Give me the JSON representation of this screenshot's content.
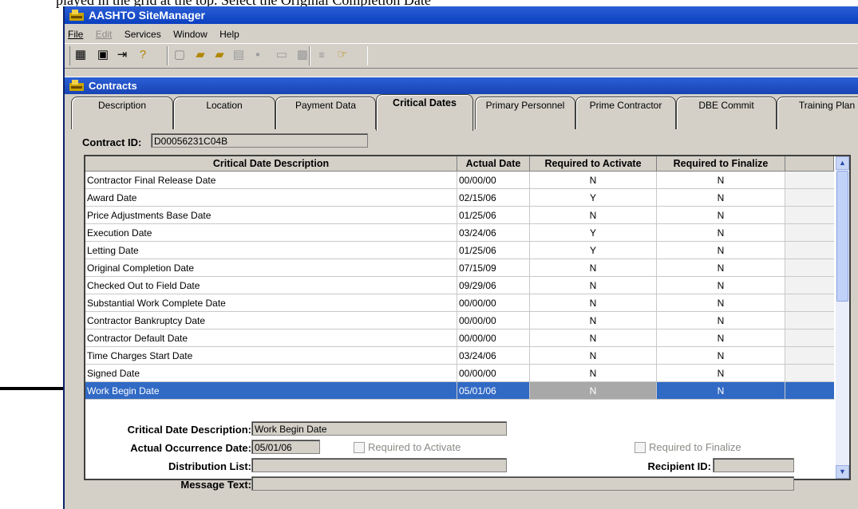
{
  "doc_text": "played in the grid at the top. Select the Original Completion Date",
  "app": {
    "title": "AASHTO SiteManager",
    "menu": [
      {
        "label": "File",
        "disabled": false
      },
      {
        "label": "Edit",
        "disabled": true
      },
      {
        "label": "Services",
        "disabled": false
      },
      {
        "label": "Window",
        "disabled": false
      },
      {
        "label": "Help",
        "disabled": false
      }
    ]
  },
  "window": {
    "title": "Contracts",
    "tabs": [
      "Description",
      "Location",
      "Payment Data",
      "Critical Dates",
      "Primary Personnel",
      "Prime Contractor",
      "DBE Commit",
      "Training Plan"
    ],
    "active_tab": "Critical Dates"
  },
  "contract": {
    "label": "Contract ID:",
    "value": "D00056231C04B"
  },
  "grid": {
    "headers": [
      "Critical Date Description",
      "Actual Date",
      "Required to Activate",
      "Required to Finalize"
    ],
    "rows": [
      {
        "desc": "Contractor Final Release Date",
        "date": "00/00/00",
        "act": "N",
        "fin": "N"
      },
      {
        "desc": "Award Date",
        "date": "02/15/06",
        "act": "Y",
        "fin": "N"
      },
      {
        "desc": "Price Adjustments Base Date",
        "date": "01/25/06",
        "act": "N",
        "fin": "N"
      },
      {
        "desc": "Execution Date",
        "date": "03/24/06",
        "act": "Y",
        "fin": "N"
      },
      {
        "desc": "Letting Date",
        "date": "01/25/06",
        "act": "Y",
        "fin": "N"
      },
      {
        "desc": "Original Completion Date",
        "date": "07/15/09",
        "act": "N",
        "fin": "N"
      },
      {
        "desc": "Checked Out to Field Date",
        "date": "09/29/06",
        "act": "N",
        "fin": "N"
      },
      {
        "desc": "Substantial Work Complete Date",
        "date": "00/00/00",
        "act": "N",
        "fin": "N"
      },
      {
        "desc": "Contractor Bankruptcy Date",
        "date": "00/00/00",
        "act": "N",
        "fin": "N"
      },
      {
        "desc": "Contractor Default Date",
        "date": "00/00/00",
        "act": "N",
        "fin": "N"
      },
      {
        "desc": "Time Charges Start Date",
        "date": "03/24/06",
        "act": "N",
        "fin": "N"
      },
      {
        "desc": "Signed Date",
        "date": "00/00/00",
        "act": "N",
        "fin": "N"
      },
      {
        "desc": "Work Begin Date",
        "date": "05/01/06",
        "act": "N",
        "fin": "N"
      }
    ],
    "selected_index": 12
  },
  "detail": {
    "desc_label": "Critical Date Description:",
    "desc_value": "Work Begin Date",
    "occ_label": "Actual Occurrence Date:",
    "occ_value": "05/01/06",
    "req_activate": "Required to Activate",
    "req_finalize": "Required to Finalize",
    "dist_label": "Distribution List:",
    "dist_value": "",
    "recipient_label": "Recipient ID:",
    "recipient_value": "",
    "msg_label": "Message Text:",
    "msg_value": ""
  },
  "colors": {
    "titlebar": "#0a3fbf",
    "selection": "#316ac5",
    "face": "#d4d0c8"
  }
}
